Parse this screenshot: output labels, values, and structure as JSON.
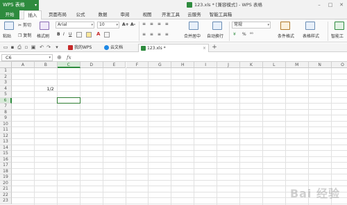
{
  "app": {
    "name": "WPS 表格",
    "doc_title": "123.xls * [兼容模式] - WPS 表格"
  },
  "menu": [
    "开始",
    "插入",
    "页面布局",
    "公式",
    "数据",
    "审阅",
    "视图",
    "开发工具",
    "云服务",
    "智能工具箱"
  ],
  "ribbon": {
    "cut": "剪切",
    "paste": "粘贴",
    "copy": "复制",
    "format_painter": "格式刷",
    "font": "Arial",
    "size": "10",
    "bigger": "A+",
    "smaller": "A-",
    "bold": "B",
    "italic": "I",
    "underline": "U",
    "merge": "合并居中",
    "wrap": "自动换行",
    "number_format": "常规",
    "currency": "¥",
    "percent": "%",
    "cond_format": "条件格式",
    "table_style": "表格样式",
    "smart_toolbox": "智能工"
  },
  "tabs": [
    {
      "label": "我的WPS",
      "color": "#c62828"
    },
    {
      "label": "云文档",
      "color": "#1e88e5"
    },
    {
      "label": "123.xls *",
      "color": "#2e8b3e"
    }
  ],
  "tab_add": "+",
  "formula": {
    "cell_ref": "C6",
    "fx": "fx",
    "value": ""
  },
  "columns": [
    "A",
    "B",
    "C",
    "D",
    "E",
    "F",
    "G",
    "H",
    "I",
    "J",
    "K",
    "L",
    "M",
    "N",
    "O"
  ],
  "rows": [
    "1",
    "2",
    "3",
    "4",
    "5",
    "6",
    "7",
    "8",
    "9",
    "10",
    "11",
    "12",
    "13",
    "14",
    "15",
    "16",
    "17",
    "18",
    "19",
    "20",
    "21",
    "22",
    "23"
  ],
  "cells": {
    "B4": "1/2"
  },
  "active_cell": "C6",
  "watermark": "Bai 经验"
}
